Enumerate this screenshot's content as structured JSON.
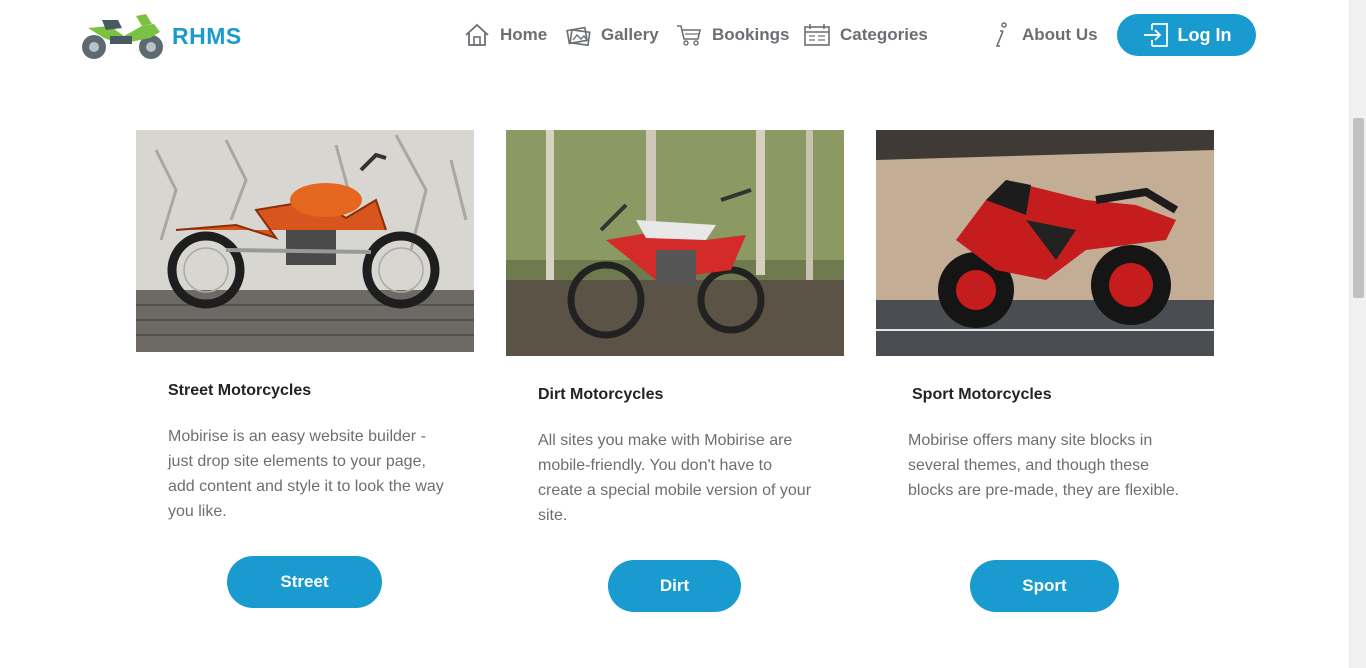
{
  "brand": {
    "name": "RHMS",
    "logo_icon": "motorcycle-icon",
    "accent": "#1a9bd0"
  },
  "nav": {
    "items": [
      {
        "label": "Home",
        "icon": "home-icon"
      },
      {
        "label": "Gallery",
        "icon": "gallery-icon"
      },
      {
        "label": "Bookings",
        "icon": "cart-icon"
      },
      {
        "label": "Categories",
        "icon": "calendar-icon"
      },
      {
        "label": "About Us",
        "icon": "info-icon"
      }
    ],
    "login_label": "Log In",
    "login_icon": "login-icon"
  },
  "cards": [
    {
      "title": "Street Motorcycles",
      "text": "Mobirise is an easy website builder - just drop site elements to your page, add content and style it to look the way you like.",
      "button": "Street",
      "image": "street-motorcycle-photo"
    },
    {
      "title": "Dirt Motorcycles",
      "text": "All sites you make with Mobirise are mobile-friendly. You don't have to create a special mobile version of your site.",
      "button": "Dirt",
      "image": "dirt-motorcycle-photo"
    },
    {
      "title": "Sport Motorcycles",
      "text": "Mobirise offers many site blocks in several themes, and though these blocks are pre-made, they are flexible.",
      "button": "Sport",
      "image": "sport-motorcycle-photo"
    }
  ]
}
